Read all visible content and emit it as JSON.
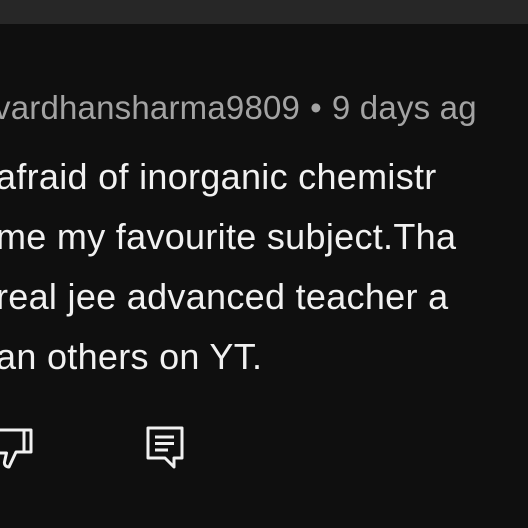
{
  "top_bar": {},
  "comment": {
    "author": "vardhansharma9809",
    "separator": "•",
    "time": "9 days ag",
    "lines": [
      "afraid of inorganic chemistr",
      "me my favourite subject.Tha",
      "real jee advanced teacher a",
      "an others on YT."
    ]
  },
  "actions": {
    "dislike_icon": "thumbs-down-icon",
    "reply_icon": "comment-reply-icon"
  },
  "colors": {
    "background": "#0f0f0f",
    "top_bar": "#272727",
    "meta_text": "#a3a3a3",
    "body_text": "#f1f1f1",
    "icon": "#f1f1f1"
  }
}
